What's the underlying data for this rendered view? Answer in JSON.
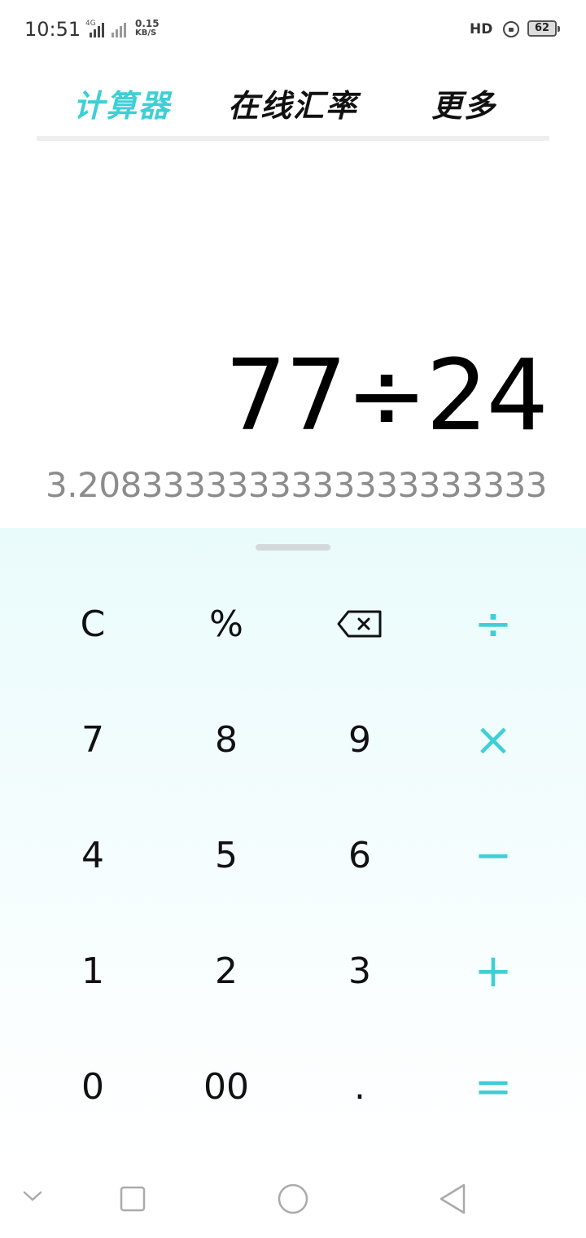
{
  "status_bar": {
    "time": "10:51",
    "network_type": "4G",
    "speed_value": "0.15",
    "speed_unit": "KB/S",
    "hd_label": "HD",
    "battery": "62"
  },
  "tabs": [
    {
      "label": "计算器",
      "active": true
    },
    {
      "label": "在线汇率",
      "active": false
    },
    {
      "label": "更多",
      "active": false
    }
  ],
  "display": {
    "expression": "77÷24",
    "result": "3.2083333333333333333333"
  },
  "keypad": {
    "clear": "C",
    "percent": "%",
    "divide": "÷",
    "multiply": "×",
    "minus": "−",
    "plus": "+",
    "equals": "=",
    "digits": {
      "d7": "7",
      "d8": "8",
      "d9": "9",
      "d4": "4",
      "d5": "5",
      "d6": "6",
      "d1": "1",
      "d2": "2",
      "d3": "3",
      "d0": "0",
      "d00": "00",
      "dot": "."
    }
  },
  "colors": {
    "accent": "#3ecfd6",
    "keypad_bg": "#eafbfc",
    "result_text": "#8c8c8c"
  },
  "icons": {
    "backspace": "backspace-icon",
    "nav_down": "chevron-down-icon",
    "nav_recent": "square-icon",
    "nav_home": "circle-icon",
    "nav_back": "triangle-back-icon"
  }
}
